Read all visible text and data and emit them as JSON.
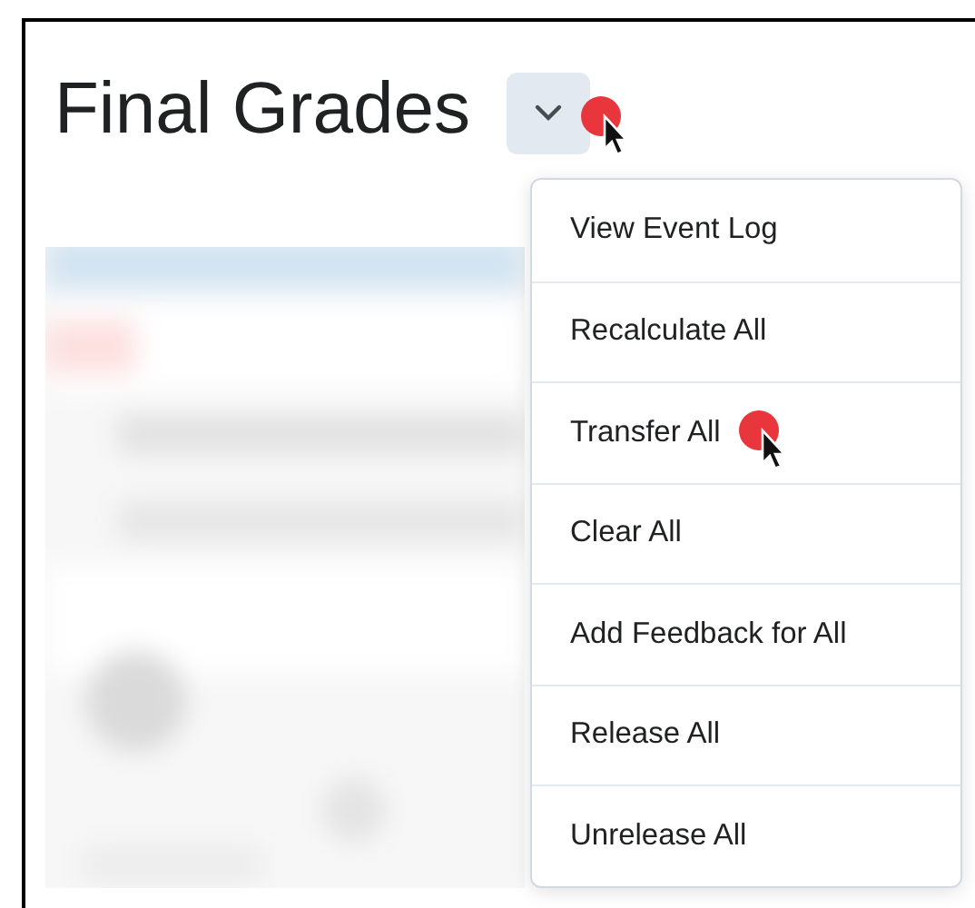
{
  "page": {
    "title": "Final Grades"
  },
  "menu_button": {
    "expanded": true
  },
  "menu": [
    {
      "label": "View Event Log"
    },
    {
      "label": "Recalculate All"
    },
    {
      "label": "Transfer All"
    },
    {
      "label": "Clear All"
    },
    {
      "label": "Add Feedback for All"
    },
    {
      "label": "Release All"
    },
    {
      "label": "Unrelease All"
    }
  ]
}
